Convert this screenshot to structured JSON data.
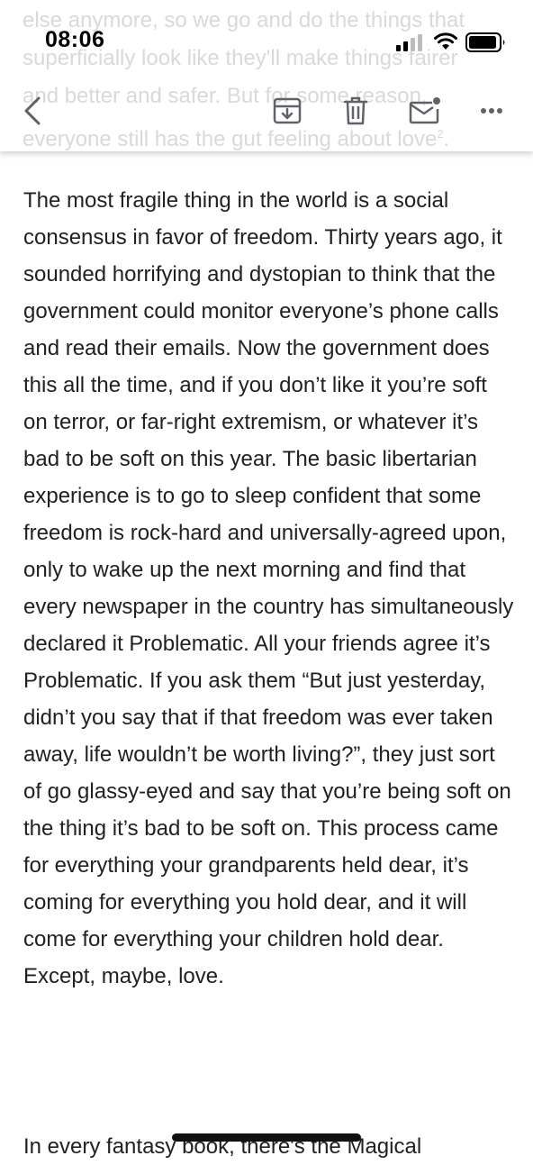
{
  "status_bar": {
    "time": "08:06"
  },
  "background_text": {
    "line1": "else anymore, so we go and do the things that",
    "line2": "superficially look like they'll make things fairer",
    "line3": "and better and safer. But for some reason,",
    "line4": "everyone still has the gut feeling about love",
    "footnote": "2",
    "line4_end": "."
  },
  "toolbar": {
    "back_icon": "chevron-left",
    "archive_icon": "archive-box",
    "delete_icon": "trash",
    "mail_icon": "envelope-unread",
    "more_icon": "ellipsis-horizontal"
  },
  "article": {
    "paragraph": "The most fragile thing in the world is a social consensus in favor of freedom. Thirty years ago, it sounded horrifying and dystopian to think that the government could monitor everyone’s phone calls and read their emails. Now the government does this all the time, and if you don’t like it you’re soft on terror, or far-right extremism, or whatever it’s bad to be soft on this year. The basic libertarian experience is to go to sleep confident that some freedom is rock-hard and universally-agreed upon, only to wake up the next morning and find that every newspaper in the country has simultaneously declared it Problematic. All your friends agree it’s Problematic. If you ask them “But just yesterday, didn’t you say that if that freedom was ever taken away, life wouldn’t be worth living?”, they just sort of go glassy-eyed and say that you’re being soft on the thing it’s bad to be soft on. This process came for everything your grandparents held dear, it’s coming for everything you hold dear, and it will come for everything your children hold dear. Except, maybe, love.",
    "next_paragraph_start": "In every fantasy book, there's the Magical"
  },
  "colors": {
    "text": "#202124",
    "icon": "#5f6368",
    "ghost_text": "#d9d9d9"
  }
}
